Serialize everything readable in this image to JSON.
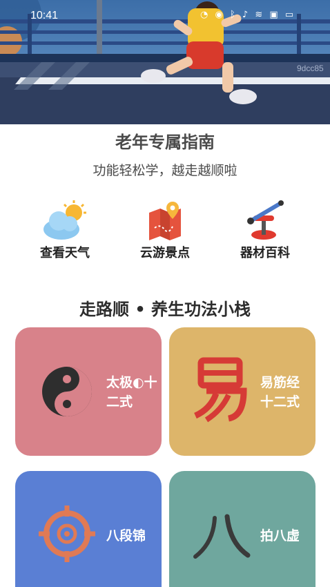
{
  "status_bar": {
    "time": "10:41",
    "icons": [
      "nfc-icon",
      "eye-icon",
      "bluetooth-icon",
      "mute-icon",
      "wifi-icon",
      "battery-saver-icon",
      "battery-icon"
    ]
  },
  "hero": {
    "watermark": "9dcc85"
  },
  "guide": {
    "title": "老年专属指南",
    "subtitle": "功能轻松学，越走越顺啦"
  },
  "shortcuts": [
    {
      "label": "查看天气",
      "icon": "weather-icon"
    },
    {
      "label": "云游景点",
      "icon": "map-icon"
    },
    {
      "label": "器材百科",
      "icon": "fitness-equipment-icon"
    }
  ],
  "section": {
    "title": "走路顺 • 养生功法小栈"
  },
  "cards": [
    {
      "label": "太极◐十\n二式",
      "icon": "taiji-icon",
      "color": "#d8828a"
    },
    {
      "label": "易筋经\n十二式",
      "icon": "yi-character-icon",
      "color": "#ddb56a"
    },
    {
      "label": "八段锦",
      "icon": "target-icon",
      "color": "#5a7fd4"
    },
    {
      "label": "拍八虚",
      "icon": "ba-character-icon",
      "color": "#6fa79e"
    }
  ]
}
